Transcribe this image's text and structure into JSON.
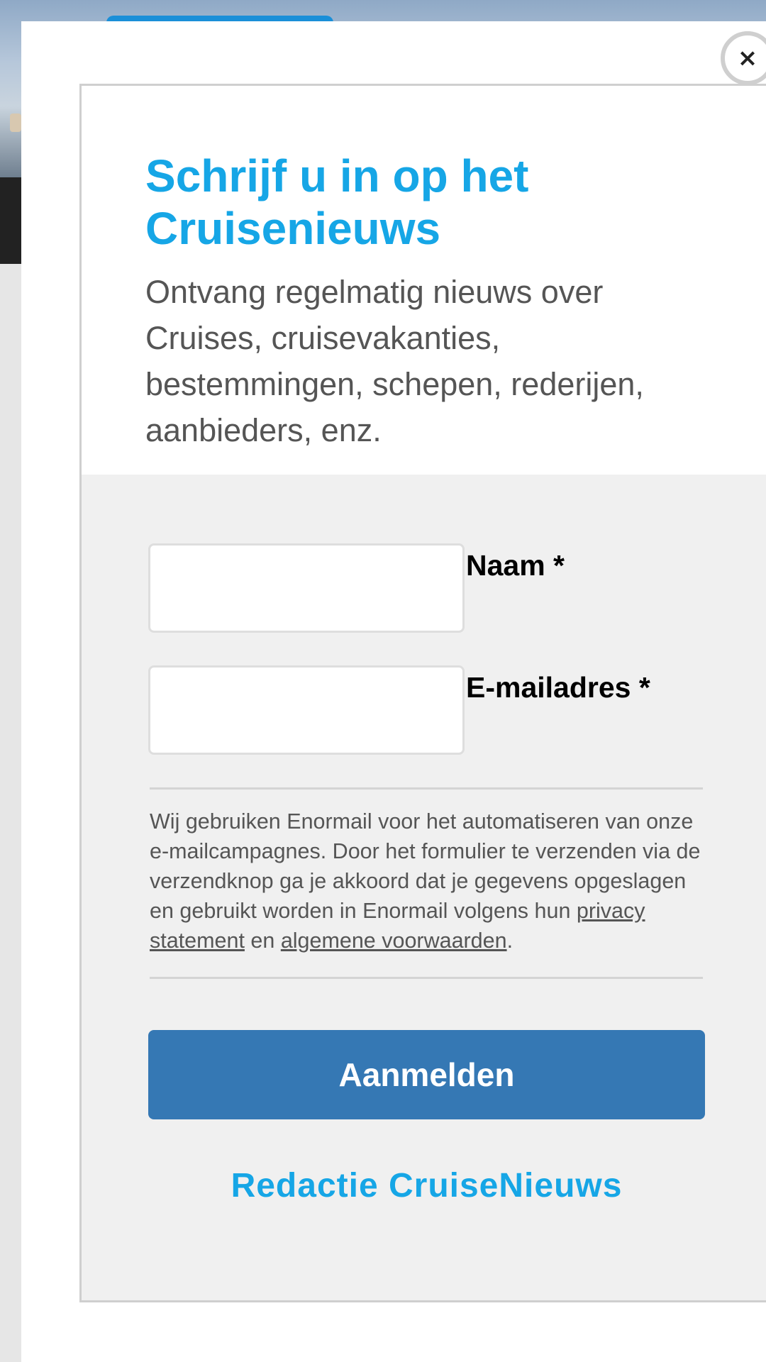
{
  "modal": {
    "close_label": "×",
    "title": "Schrijf u in op het Cruisenieuws",
    "subtitle": "Ontvang regelmatig nieuws over Cruises, cruisevakanties, bestemmingen, schepen, rederijen, aanbieders, enz."
  },
  "form": {
    "name_label": "Naam *",
    "name_value": "",
    "email_label": "E-mailadres *",
    "email_value": "",
    "consent": {
      "text_before": "Wij gebruiken Enormail voor het automatiseren van onze e-mailcampagnes. Door het formulier te verzenden via de verzendknop ga je akkoord dat je gegevens opgeslagen en gebruikt worden in Enormail volgens hun ",
      "privacy_link": "privacy statement",
      "text_middle": " en ",
      "terms_link": "algemene voorwaarden",
      "text_after": "."
    },
    "submit_label": "Aanmelden",
    "signature": "Redactie CruiseNieuws"
  },
  "colors": {
    "accent": "#16a6e6",
    "button": "#3578b4",
    "panel": "#f0f0f0"
  },
  "icons": {
    "close": "close-icon"
  }
}
